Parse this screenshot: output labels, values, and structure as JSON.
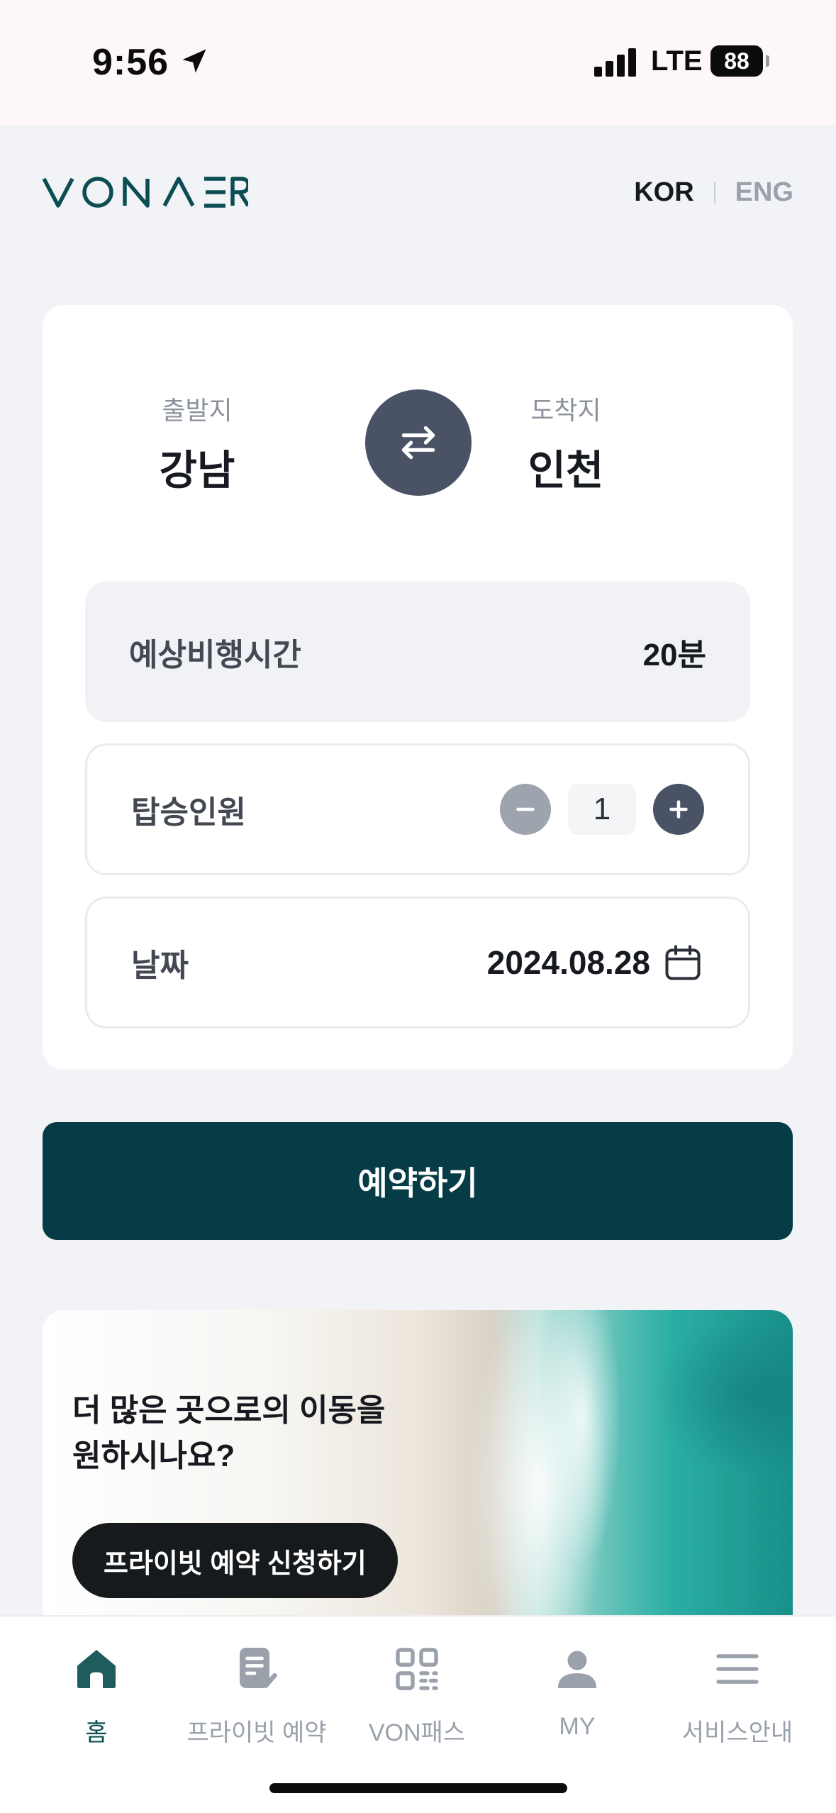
{
  "status": {
    "time": "9:56",
    "network": "LTE",
    "battery": "88"
  },
  "header": {
    "logo_text": "VONAER",
    "lang_kor": "KOR",
    "lang_eng": "ENG"
  },
  "route": {
    "from_caption": "출발지",
    "from_place": "강남",
    "to_caption": "도착지",
    "to_place": "인천"
  },
  "flight_time": {
    "label": "예상비행시간",
    "value": "20분"
  },
  "passengers": {
    "label": "탑승인원",
    "count": "1"
  },
  "date": {
    "label": "날짜",
    "value": "2024.08.28"
  },
  "reserve_button": "예약하기",
  "banner": {
    "line1": "더 많은 곳으로의 이동을",
    "line2": "원하시나요?",
    "cta": "프라이빗 예약 신청하기"
  },
  "tabs": [
    {
      "label": "홈",
      "icon": "home-icon",
      "active": true
    },
    {
      "label": "프라이빗 예약",
      "icon": "document-check-icon",
      "active": false
    },
    {
      "label": "VON패스",
      "icon": "qr-code-icon",
      "active": false
    },
    {
      "label": "MY",
      "icon": "person-icon",
      "active": false
    },
    {
      "label": "서비스안내",
      "icon": "menu-icon",
      "active": false
    }
  ],
  "colors": {
    "primary": "#063c45",
    "swap": "#4a5266",
    "background": "#f2f3f6"
  }
}
